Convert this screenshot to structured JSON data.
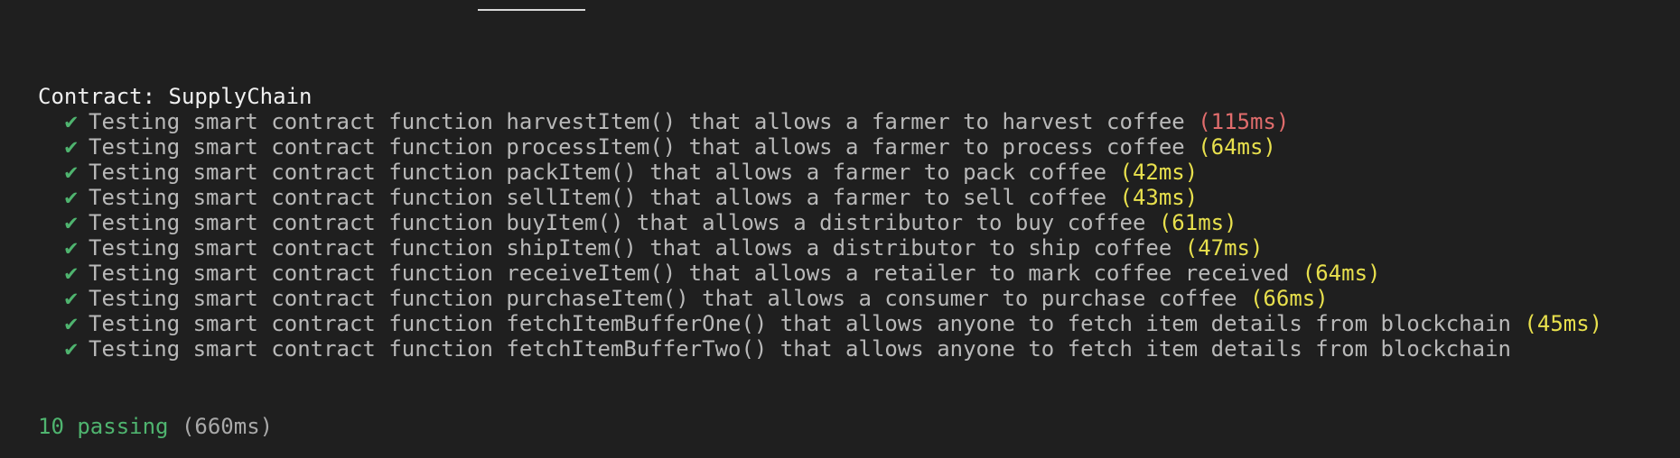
{
  "terminal": {
    "suite_title": "Contract: SupplyChain",
    "check_icon": "✔",
    "tests": [
      {
        "label": "Testing smart contract function harvestItem() that allows a farmer to harvest coffee",
        "duration": "(115ms)",
        "duration_level": "slow"
      },
      {
        "label": "Testing smart contract function processItem() that allows a farmer to process coffee",
        "duration": "(64ms)",
        "duration_level": "medium"
      },
      {
        "label": "Testing smart contract function packItem() that allows a farmer to pack coffee",
        "duration": "(42ms)",
        "duration_level": "medium"
      },
      {
        "label": "Testing smart contract function sellItem() that allows a farmer to sell coffee",
        "duration": "(43ms)",
        "duration_level": "medium"
      },
      {
        "label": "Testing smart contract function buyItem() that allows a distributor to buy coffee",
        "duration": "(61ms)",
        "duration_level": "medium"
      },
      {
        "label": "Testing smart contract function shipItem() that allows a distributor to ship coffee",
        "duration": "(47ms)",
        "duration_level": "medium"
      },
      {
        "label": "Testing smart contract function receiveItem() that allows a retailer to mark coffee received",
        "duration": "(64ms)",
        "duration_level": "medium"
      },
      {
        "label": "Testing smart contract function purchaseItem() that allows a consumer to purchase coffee",
        "duration": "(66ms)",
        "duration_level": "medium"
      },
      {
        "label": "Testing smart contract function fetchItemBufferOne() that allows anyone to fetch item details from blockchain",
        "duration": "(45ms)",
        "duration_level": "medium"
      },
      {
        "label": "Testing smart contract function fetchItemBufferTwo() that allows anyone to fetch item details from blockchain",
        "duration": "",
        "duration_level": "none"
      }
    ],
    "summary": {
      "passing": "10 passing",
      "total_time": "(660ms)"
    }
  },
  "colors": {
    "background": "#1f1f1f",
    "check": "#4fb46f",
    "slow": "#e06c6c",
    "medium": "#e8e04d"
  }
}
